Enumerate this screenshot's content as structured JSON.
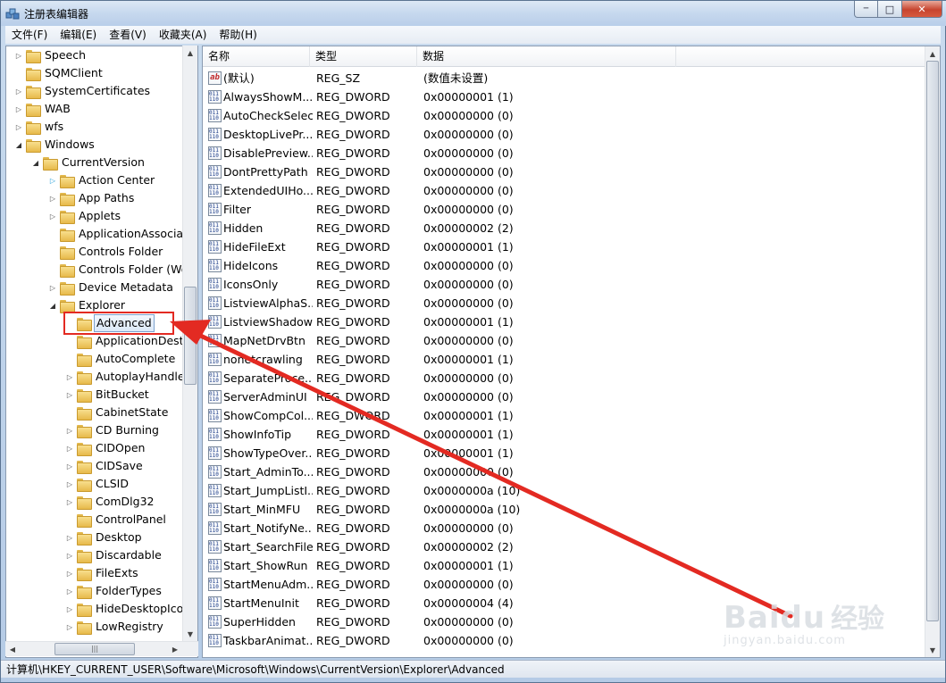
{
  "window": {
    "title": "注册表编辑器",
    "minimize": "─",
    "maximize": "□",
    "close": "✕"
  },
  "menu": [
    "文件(F)",
    "编辑(E)",
    "查看(V)",
    "收藏夹(A)",
    "帮助(H)"
  ],
  "tree": [
    {
      "label": "Speech",
      "depth": 0,
      "exp": "closed"
    },
    {
      "label": "SQMClient",
      "depth": 0,
      "exp": "none"
    },
    {
      "label": "SystemCertificates",
      "depth": 0,
      "exp": "closed"
    },
    {
      "label": "WAB",
      "depth": 0,
      "exp": "closed"
    },
    {
      "label": "wfs",
      "depth": 0,
      "exp": "closed"
    },
    {
      "label": "Windows",
      "depth": 0,
      "exp": "open"
    },
    {
      "label": "CurrentVersion",
      "depth": 1,
      "exp": "open"
    },
    {
      "label": "Action Center",
      "depth": 2,
      "exp": "hover"
    },
    {
      "label": "App Paths",
      "depth": 2,
      "exp": "closed"
    },
    {
      "label": "Applets",
      "depth": 2,
      "exp": "closed"
    },
    {
      "label": "ApplicationAssociat",
      "depth": 2,
      "exp": "none"
    },
    {
      "label": "Controls Folder",
      "depth": 2,
      "exp": "none"
    },
    {
      "label": "Controls Folder (Wo",
      "depth": 2,
      "exp": "none"
    },
    {
      "label": "Device Metadata",
      "depth": 2,
      "exp": "closed"
    },
    {
      "label": "Explorer",
      "depth": 2,
      "exp": "open"
    },
    {
      "label": "Advanced",
      "depth": 3,
      "exp": "none",
      "selected": true
    },
    {
      "label": "ApplicationDesti",
      "depth": 3,
      "exp": "none"
    },
    {
      "label": "AutoComplete",
      "depth": 3,
      "exp": "none"
    },
    {
      "label": "AutoplayHandler",
      "depth": 3,
      "exp": "closed"
    },
    {
      "label": "BitBucket",
      "depth": 3,
      "exp": "closed"
    },
    {
      "label": "CabinetState",
      "depth": 3,
      "exp": "none"
    },
    {
      "label": "CD Burning",
      "depth": 3,
      "exp": "closed"
    },
    {
      "label": "CIDOpen",
      "depth": 3,
      "exp": "closed"
    },
    {
      "label": "CIDSave",
      "depth": 3,
      "exp": "closed"
    },
    {
      "label": "CLSID",
      "depth": 3,
      "exp": "closed"
    },
    {
      "label": "ComDlg32",
      "depth": 3,
      "exp": "closed"
    },
    {
      "label": "ControlPanel",
      "depth": 3,
      "exp": "none"
    },
    {
      "label": "Desktop",
      "depth": 3,
      "exp": "closed"
    },
    {
      "label": "Discardable",
      "depth": 3,
      "exp": "closed"
    },
    {
      "label": "FileExts",
      "depth": 3,
      "exp": "closed"
    },
    {
      "label": "FolderTypes",
      "depth": 3,
      "exp": "closed"
    },
    {
      "label": "HideDesktopIco",
      "depth": 3,
      "exp": "closed"
    },
    {
      "label": "LowRegistry",
      "depth": 3,
      "exp": "closed"
    }
  ],
  "columns": [
    "名称",
    "类型",
    "数据"
  ],
  "values": [
    {
      "name": "(默认)",
      "type": "REG_SZ",
      "data": "(数值未设置)",
      "kind": "sz"
    },
    {
      "name": "AlwaysShowM...",
      "type": "REG_DWORD",
      "data": "0x00000001 (1)",
      "kind": "dw"
    },
    {
      "name": "AutoCheckSelect",
      "type": "REG_DWORD",
      "data": "0x00000000 (0)",
      "kind": "dw"
    },
    {
      "name": "DesktopLivePr...",
      "type": "REG_DWORD",
      "data": "0x00000000 (0)",
      "kind": "dw"
    },
    {
      "name": "DisablePreview...",
      "type": "REG_DWORD",
      "data": "0x00000000 (0)",
      "kind": "dw"
    },
    {
      "name": "DontPrettyPath",
      "type": "REG_DWORD",
      "data": "0x00000000 (0)",
      "kind": "dw"
    },
    {
      "name": "ExtendedUIHo...",
      "type": "REG_DWORD",
      "data": "0x00000000 (0)",
      "kind": "dw"
    },
    {
      "name": "Filter",
      "type": "REG_DWORD",
      "data": "0x00000000 (0)",
      "kind": "dw"
    },
    {
      "name": "Hidden",
      "type": "REG_DWORD",
      "data": "0x00000002 (2)",
      "kind": "dw"
    },
    {
      "name": "HideFileExt",
      "type": "REG_DWORD",
      "data": "0x00000001 (1)",
      "kind": "dw"
    },
    {
      "name": "HideIcons",
      "type": "REG_DWORD",
      "data": "0x00000000 (0)",
      "kind": "dw"
    },
    {
      "name": "IconsOnly",
      "type": "REG_DWORD",
      "data": "0x00000000 (0)",
      "kind": "dw"
    },
    {
      "name": "ListviewAlphaS...",
      "type": "REG_DWORD",
      "data": "0x00000000 (0)",
      "kind": "dw"
    },
    {
      "name": "ListviewShadow",
      "type": "REG_DWORD",
      "data": "0x00000001 (1)",
      "kind": "dw"
    },
    {
      "name": "MapNetDrvBtn",
      "type": "REG_DWORD",
      "data": "0x00000000 (0)",
      "kind": "dw"
    },
    {
      "name": "nonetcrawling",
      "type": "REG_DWORD",
      "data": "0x00000001 (1)",
      "kind": "dw"
    },
    {
      "name": "SeparateProce...",
      "type": "REG_DWORD",
      "data": "0x00000000 (0)",
      "kind": "dw"
    },
    {
      "name": "ServerAdminUI",
      "type": "REG_DWORD",
      "data": "0x00000000 (0)",
      "kind": "dw"
    },
    {
      "name": "ShowCompCol...",
      "type": "REG_DWORD",
      "data": "0x00000001 (1)",
      "kind": "dw"
    },
    {
      "name": "ShowInfoTip",
      "type": "REG_DWORD",
      "data": "0x00000001 (1)",
      "kind": "dw"
    },
    {
      "name": "ShowTypeOver...",
      "type": "REG_DWORD",
      "data": "0x00000001 (1)",
      "kind": "dw"
    },
    {
      "name": "Start_AdminTo...",
      "type": "REG_DWORD",
      "data": "0x00000000 (0)",
      "kind": "dw"
    },
    {
      "name": "Start_JumpListI...",
      "type": "REG_DWORD",
      "data": "0x0000000a (10)",
      "kind": "dw"
    },
    {
      "name": "Start_MinMFU",
      "type": "REG_DWORD",
      "data": "0x0000000a (10)",
      "kind": "dw"
    },
    {
      "name": "Start_NotifyNe...",
      "type": "REG_DWORD",
      "data": "0x00000000 (0)",
      "kind": "dw"
    },
    {
      "name": "Start_SearchFiles",
      "type": "REG_DWORD",
      "data": "0x00000002 (2)",
      "kind": "dw"
    },
    {
      "name": "Start_ShowRun",
      "type": "REG_DWORD",
      "data": "0x00000001 (1)",
      "kind": "dw"
    },
    {
      "name": "StartMenuAdm...",
      "type": "REG_DWORD",
      "data": "0x00000000 (0)",
      "kind": "dw"
    },
    {
      "name": "StartMenuInit",
      "type": "REG_DWORD",
      "data": "0x00000004 (4)",
      "kind": "dw"
    },
    {
      "name": "SuperHidden",
      "type": "REG_DWORD",
      "data": "0x00000000 (0)",
      "kind": "dw"
    },
    {
      "name": "TaskbarAnimat...",
      "type": "REG_DWORD",
      "data": "0x00000000 (0)",
      "kind": "dw"
    }
  ],
  "value_icon": {
    "sz": "ab",
    "dw": "011 110"
  },
  "status": "计算机\\HKEY_CURRENT_USER\\Software\\Microsoft\\Windows\\CurrentVersion\\Explorer\\Advanced",
  "scroll": {
    "up": "▲",
    "down": "▼",
    "left": "◀",
    "right": "▶",
    "grip": "|||"
  },
  "watermark": {
    "brand": "Baidu",
    "cn": "经验",
    "url": "jingyan.baidu.com"
  },
  "colors": {
    "annotation": "#e32a22",
    "selection_border": "#7da2ce"
  }
}
